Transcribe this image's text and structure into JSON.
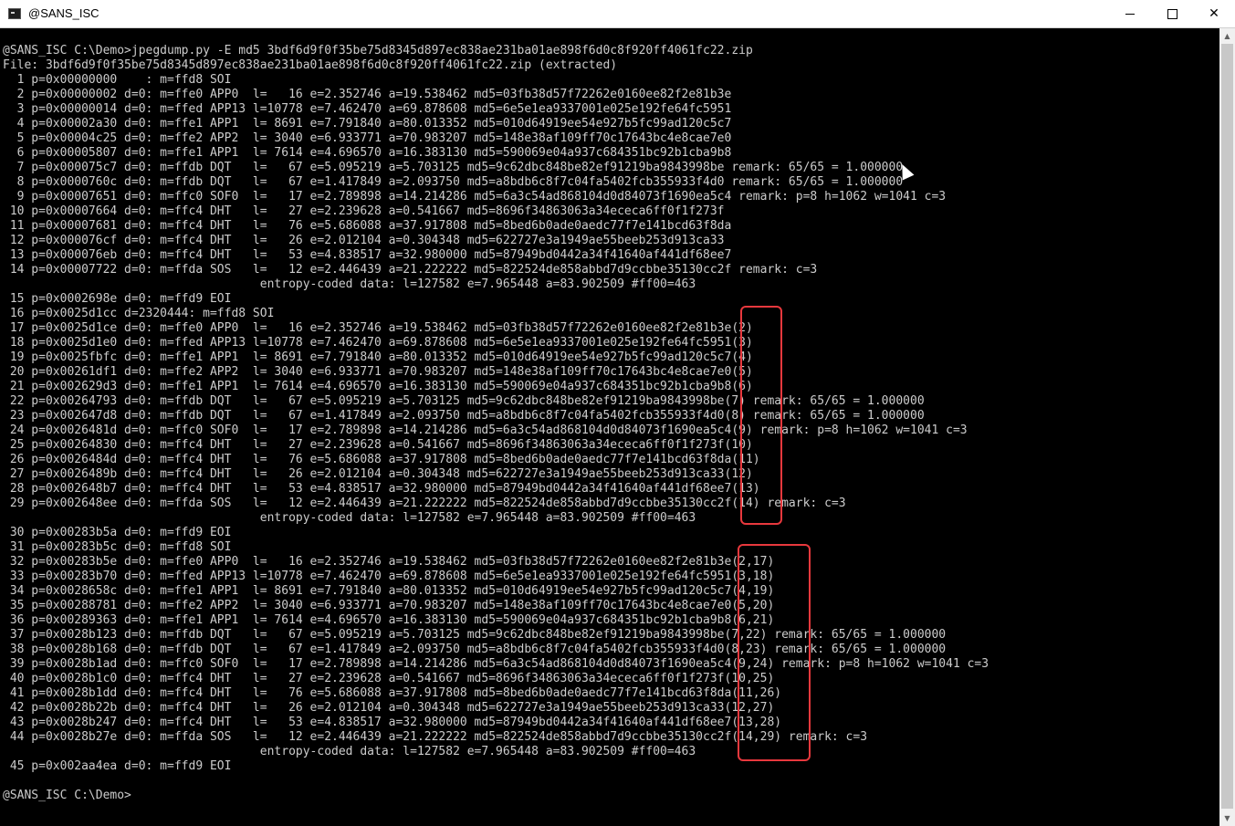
{
  "window": {
    "title": "@SANS_ISC",
    "minimize_label": "—",
    "maximize_label": "☐",
    "close_label": "✕"
  },
  "console": {
    "lines": [
      "@SANS_ISC C:\\Demo>jpegdump.py -E md5 3bdf6d9f0f35be75d8345d897ec838ae231ba01ae898f6d0c8f920ff4061fc22.zip",
      "File: 3bdf6d9f0f35be75d8345d897ec838ae231ba01ae898f6d0c8f920ff4061fc22.zip (extracted)",
      "  1 p=0x00000000    : m=ffd8 SOI",
      "  2 p=0x00000002 d=0: m=ffe0 APP0  l=   16 e=2.352746 a=19.538462 md5=03fb38d57f72262e0160ee82f2e81b3e",
      "  3 p=0x00000014 d=0: m=ffed APP13 l=10778 e=7.462470 a=69.878608 md5=6e5e1ea9337001e025e192fe64fc5951",
      "  4 p=0x00002a30 d=0: m=ffe1 APP1  l= 8691 e=7.791840 a=80.013352 md5=010d64919ee54e927b5fc99ad120c5c7",
      "  5 p=0x00004c25 d=0: m=ffe2 APP2  l= 3040 e=6.933771 a=70.983207 md5=148e38af109ff70c17643bc4e8cae7e0",
      "  6 p=0x00005807 d=0: m=ffe1 APP1  l= 7614 e=4.696570 a=16.383130 md5=590069e04a937c684351bc92b1cba9b8",
      "  7 p=0x000075c7 d=0: m=ffdb DQT   l=   67 e=5.095219 a=5.703125 md5=9c62dbc848be82ef91219ba9843998be remark: 65/65 = 1.000000",
      "  8 p=0x0000760c d=0: m=ffdb DQT   l=   67 e=1.417849 a=2.093750 md5=a8bdb6c8f7c04fa5402fcb355933f4d0 remark: 65/65 = 1.000000",
      "  9 p=0x00007651 d=0: m=ffc0 SOF0  l=   17 e=2.789898 a=14.214286 md5=6a3c54ad868104d0d84073f1690ea5c4 remark: p=8 h=1062 w=1041 c=3",
      " 10 p=0x00007664 d=0: m=ffc4 DHT   l=   27 e=2.239628 a=0.541667 md5=8696f34863063a34ececa6ff0f1f273f",
      " 11 p=0x00007681 d=0: m=ffc4 DHT   l=   76 e=5.686088 a=37.917808 md5=8bed6b0ade0aedc77f7e141bcd63f8da",
      " 12 p=0x000076cf d=0: m=ffc4 DHT   l=   26 e=2.012104 a=0.304348 md5=622727e3a1949ae55beeb253d913ca33",
      " 13 p=0x000076eb d=0: m=ffc4 DHT   l=   53 e=4.838517 a=32.980000 md5=87949bd0442a34f41640af441df68ee7",
      " 14 p=0x00007722 d=0: m=ffda SOS   l=   12 e=2.446439 a=21.222222 md5=822524de858abbd7d9ccbbe35130cc2f remark: c=3",
      "                                    entropy-coded data: l=127582 e=7.965448 a=83.902509 #ff00=463",
      " 15 p=0x0002698e d=0: m=ffd9 EOI",
      " 16 p=0x0025d1cc d=2320444: m=ffd8 SOI",
      " 17 p=0x0025d1ce d=0: m=ffe0 APP0  l=   16 e=2.352746 a=19.538462 md5=03fb38d57f72262e0160ee82f2e81b3e(2)",
      " 18 p=0x0025d1e0 d=0: m=ffed APP13 l=10778 e=7.462470 a=69.878608 md5=6e5e1ea9337001e025e192fe64fc5951(3)",
      " 19 p=0x0025fbfc d=0: m=ffe1 APP1  l= 8691 e=7.791840 a=80.013352 md5=010d64919ee54e927b5fc99ad120c5c7(4)",
      " 20 p=0x00261df1 d=0: m=ffe2 APP2  l= 3040 e=6.933771 a=70.983207 md5=148e38af109ff70c17643bc4e8cae7e0(5)",
      " 21 p=0x002629d3 d=0: m=ffe1 APP1  l= 7614 e=4.696570 a=16.383130 md5=590069e04a937c684351bc92b1cba9b8(6)",
      " 22 p=0x00264793 d=0: m=ffdb DQT   l=   67 e=5.095219 a=5.703125 md5=9c62dbc848be82ef91219ba9843998be(7) remark: 65/65 = 1.000000",
      " 23 p=0x002647d8 d=0: m=ffdb DQT   l=   67 e=1.417849 a=2.093750 md5=a8bdb6c8f7c04fa5402fcb355933f4d0(8) remark: 65/65 = 1.000000",
      " 24 p=0x0026481d d=0: m=ffc0 SOF0  l=   17 e=2.789898 a=14.214286 md5=6a3c54ad868104d0d84073f1690ea5c4(9) remark: p=8 h=1062 w=1041 c=3",
      " 25 p=0x00264830 d=0: m=ffc4 DHT   l=   27 e=2.239628 a=0.541667 md5=8696f34863063a34ececa6ff0f1f273f(10)",
      " 26 p=0x0026484d d=0: m=ffc4 DHT   l=   76 e=5.686088 a=37.917808 md5=8bed6b0ade0aedc77f7e141bcd63f8da(11)",
      " 27 p=0x0026489b d=0: m=ffc4 DHT   l=   26 e=2.012104 a=0.304348 md5=622727e3a1949ae55beeb253d913ca33(12)",
      " 28 p=0x002648b7 d=0: m=ffc4 DHT   l=   53 e=4.838517 a=32.980000 md5=87949bd0442a34f41640af441df68ee7(13)",
      " 29 p=0x002648ee d=0: m=ffda SOS   l=   12 e=2.446439 a=21.222222 md5=822524de858abbd7d9ccbbe35130cc2f(14) remark: c=3",
      "                                    entropy-coded data: l=127582 e=7.965448 a=83.902509 #ff00=463",
      " 30 p=0x00283b5a d=0: m=ffd9 EOI",
      " 31 p=0x00283b5c d=0: m=ffd8 SOI",
      " 32 p=0x00283b5e d=0: m=ffe0 APP0  l=   16 e=2.352746 a=19.538462 md5=03fb38d57f72262e0160ee82f2e81b3e(2,17)",
      " 33 p=0x00283b70 d=0: m=ffed APP13 l=10778 e=7.462470 a=69.878608 md5=6e5e1ea9337001e025e192fe64fc5951(3,18)",
      " 34 p=0x0028658c d=0: m=ffe1 APP1  l= 8691 e=7.791840 a=80.013352 md5=010d64919ee54e927b5fc99ad120c5c7(4,19)",
      " 35 p=0x00288781 d=0: m=ffe2 APP2  l= 3040 e=6.933771 a=70.983207 md5=148e38af109ff70c17643bc4e8cae7e0(5,20)",
      " 36 p=0x00289363 d=0: m=ffe1 APP1  l= 7614 e=4.696570 a=16.383130 md5=590069e04a937c684351bc92b1cba9b8(6,21)",
      " 37 p=0x0028b123 d=0: m=ffdb DQT   l=   67 e=5.095219 a=5.703125 md5=9c62dbc848be82ef91219ba9843998be(7,22) remark: 65/65 = 1.000000",
      " 38 p=0x0028b168 d=0: m=ffdb DQT   l=   67 e=1.417849 a=2.093750 md5=a8bdb6c8f7c04fa5402fcb355933f4d0(8,23) remark: 65/65 = 1.000000",
      " 39 p=0x0028b1ad d=0: m=ffc0 SOF0  l=   17 e=2.789898 a=14.214286 md5=6a3c54ad868104d0d84073f1690ea5c4(9,24) remark: p=8 h=1062 w=1041 c=3",
      " 40 p=0x0028b1c0 d=0: m=ffc4 DHT   l=   27 e=2.239628 a=0.541667 md5=8696f34863063a34ececa6ff0f1f273f(10,25)",
      " 41 p=0x0028b1dd d=0: m=ffc4 DHT   l=   76 e=5.686088 a=37.917808 md5=8bed6b0ade0aedc77f7e141bcd63f8da(11,26)",
      " 42 p=0x0028b22b d=0: m=ffc4 DHT   l=   26 e=2.012104 a=0.304348 md5=622727e3a1949ae55beeb253d913ca33(12,27)",
      " 43 p=0x0028b247 d=0: m=ffc4 DHT   l=   53 e=4.838517 a=32.980000 md5=87949bd0442a34f41640af441df68ee7(13,28)",
      " 44 p=0x0028b27e d=0: m=ffda SOS   l=   12 e=2.446439 a=21.222222 md5=822524de858abbd7d9ccbbe35130cc2f(14,29) remark: c=3",
      "                                    entropy-coded data: l=127582 e=7.965448 a=83.902509 #ff00=463",
      " 45 p=0x002aa4ea d=0: m=ffd9 EOI",
      "",
      "@SANS_ISC C:\\Demo>"
    ]
  },
  "colors": {
    "console_bg": "#000000",
    "console_text": "#cccccc",
    "highlight": "#e8383d"
  }
}
